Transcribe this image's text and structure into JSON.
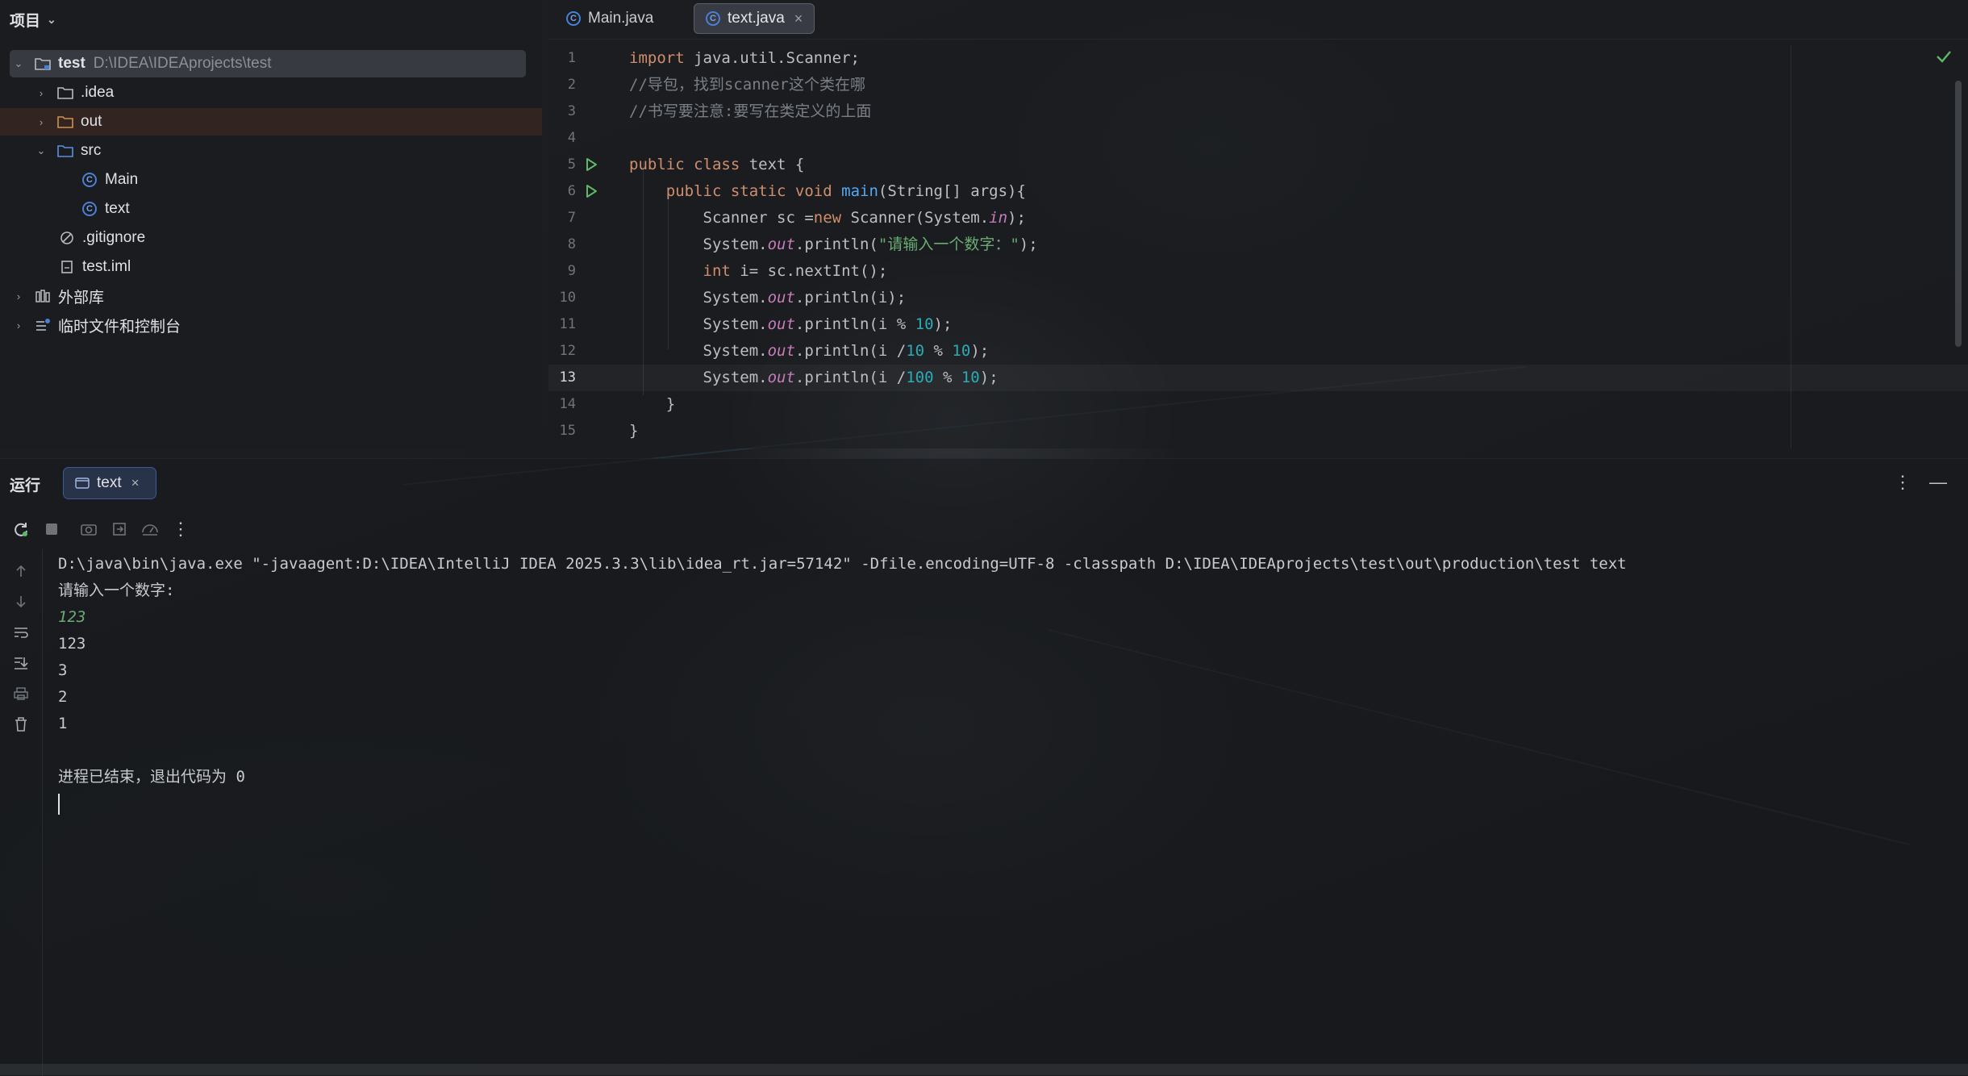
{
  "project_panel": {
    "title": "项目",
    "tree": [
      {
        "label": "test",
        "path": "D:\\IDEA\\IDEAprojects\\test"
      },
      {
        "label": ".idea"
      },
      {
        "label": "out"
      },
      {
        "label": "src"
      },
      {
        "label": "Main"
      },
      {
        "label": "text"
      },
      {
        "label": ".gitignore"
      },
      {
        "label": "test.iml"
      },
      {
        "label": "外部库"
      },
      {
        "label": "临时文件和控制台"
      }
    ]
  },
  "editor": {
    "tabs": [
      {
        "label": "Main.java",
        "active": false
      },
      {
        "label": "text.java",
        "active": true
      }
    ],
    "current_line": 13,
    "line_numbers": [
      "1",
      "2",
      "3",
      "4",
      "5",
      "6",
      "7",
      "8",
      "9",
      "10",
      "11",
      "12",
      "13",
      "14",
      "15"
    ]
  },
  "run_panel": {
    "title": "运行",
    "tab_label": "text",
    "console_lines": [
      "D:\\java\\bin\\java.exe \"-javaagent:D:\\IDEA\\IntelliJ IDEA 2025.3.3\\lib\\idea_rt.jar=57142\" -Dfile.encoding=UTF-8 -classpath D:\\IDEA\\IDEAprojects\\test\\out\\production\\test text",
      "请输入一个数字:",
      "123",
      "123",
      "3",
      "2",
      "1",
      "",
      "进程已结束，退出代码为 0"
    ]
  },
  "colors": {
    "keyword": "#cf8e6d",
    "comment": "#7a7e85",
    "string": "#6aab73",
    "number": "#2aacb8",
    "static_field": "#c77dbb",
    "method_decl": "#56a8f5",
    "accent": "#3e5a92"
  }
}
